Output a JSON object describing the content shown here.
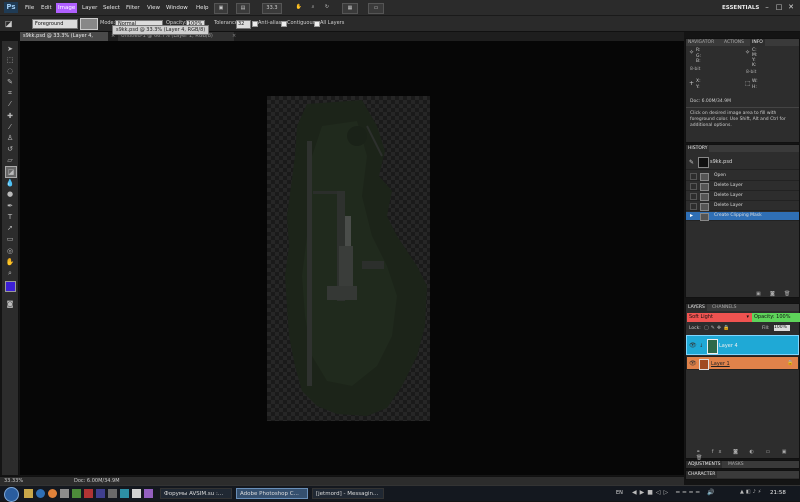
{
  "app": {
    "logo": "Ps",
    "menus": [
      "File",
      "Edit",
      "Image",
      "Layer",
      "Select",
      "Filter",
      "View",
      "Window",
      "Help"
    ],
    "active_menu": "Image",
    "zoom_field": "33.3",
    "workspace": "ESSENTIALS",
    "window_controls": [
      "–",
      "□",
      "✕"
    ]
  },
  "options": {
    "fill_source": "Foreground",
    "mode_label": "Mode:",
    "mode_value": "Normal",
    "opacity_label": "Opacity:",
    "opacity_value": "100%",
    "tolerance_label": "Tolerance:",
    "tolerance_value": "32",
    "anti_alias": "Anti-alias",
    "contiguous": "Contiguous",
    "all_layers": "All Layers"
  },
  "documents": {
    "tab1": "s9kk.psd @ 33.3% (Layer 4, RGB/8)",
    "tab1_close": "×",
    "tab2": "Untitled-1 @ 66.7% (Layer 1, RGB/8)",
    "tab2_close": "×",
    "tooltip": "s9kk.psd @ 33.3% (Layer 4, RGB/8)"
  },
  "status": {
    "zoom": "33.33%",
    "doc": "Doc: 6.00M/34.9M"
  },
  "info_panel": {
    "tabs": [
      "NAVIGATOR",
      "ACTIONS",
      "INFO"
    ],
    "active": "INFO",
    "r": "R:",
    "g": "G:",
    "b": "B:",
    "c": "C:",
    "m": "M:",
    "y": "Y:",
    "k": "K:",
    "bits1": "8-bit",
    "bits2": "8-bit",
    "x": "X:",
    "y_coord": "Y:",
    "w": "W:",
    "h": "H:",
    "doc": "Doc: 6.00M/34.9M",
    "hint": "Click on desired image area to fill with foreground color. Use Shift, Alt and Ctrl for additional options."
  },
  "history_panel": {
    "title": "HISTORY",
    "snapshot": "s9kk.psd",
    "steps": [
      "Open",
      "Delete Layer",
      "Delete Layer",
      "Delete Layer",
      "Create Clipping Mask"
    ],
    "selected_index": 4
  },
  "layers_panel": {
    "tabs": [
      "LAYERS",
      "CHANNELS"
    ],
    "blend_mode": "Soft Light",
    "opacity_label": "Opacity:",
    "opacity_value": "100%",
    "lock_label": "Lock:",
    "fill_label": "Fill:",
    "fill_value": "100%",
    "layers": [
      {
        "name": "Layer 4",
        "color": "#1fa9d6",
        "selected": true
      },
      {
        "name": "Layer 1",
        "color": "#e0824a",
        "selected": false
      }
    ]
  },
  "adjustments_panel": {
    "tabs": [
      "ADJUSTMENTS",
      "MASKS"
    ]
  },
  "character_panel": {
    "title": "CHARACTER"
  },
  "colors": {
    "foreground": "#3c1fd6",
    "background": "#ffffff",
    "menu_highlight": "#b060ff",
    "blend_red": "#ef5350",
    "opacity_green": "#5ed45a",
    "layer4_blue": "#1fa9d6",
    "layer1_orange": "#e0824a",
    "history_selected": "#2f6fb5"
  },
  "taskbar": {
    "items": [
      "Форумы AVSIM.su :...",
      "Adobe Photoshop C...",
      "[jetmord] - Messagin..."
    ],
    "active_index": 1,
    "lang": "EN",
    "clock": "21:58"
  }
}
